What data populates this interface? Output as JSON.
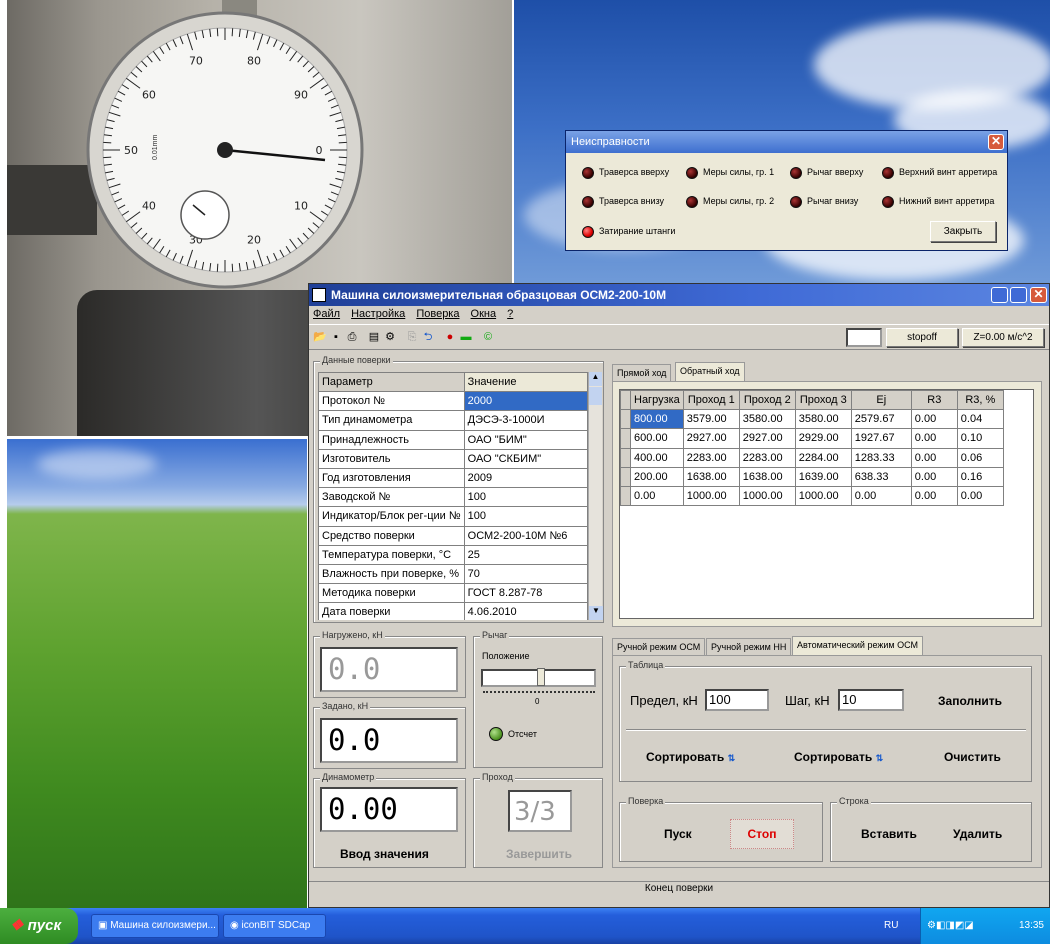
{
  "fault_dialog": {
    "title": "Неисправности",
    "items": [
      {
        "label": "Траверса вверху",
        "state": "off"
      },
      {
        "label": "Меры силы, гр. 1",
        "state": "off"
      },
      {
        "label": "Рычаг вверху",
        "state": "off"
      },
      {
        "label": "Верхний винт арретира",
        "state": "off"
      },
      {
        "label": "Траверса внизу",
        "state": "off"
      },
      {
        "label": "Меры силы, гр. 2",
        "state": "off"
      },
      {
        "label": "Рычаг внизу",
        "state": "off"
      },
      {
        "label": "Нижний винт арретира",
        "state": "off"
      },
      {
        "label": "Затирание штанги",
        "state": "on"
      }
    ],
    "close_label": "Закрыть"
  },
  "window": {
    "title": "Машина силоизмерительная образцовая ОСМ2-200-10М",
    "menu": [
      "Файл",
      "Настройка",
      "Поверка",
      "Окна",
      "?"
    ],
    "stop_button": "stopoff",
    "z_readout": "Z=0.00 м/с^2"
  },
  "params": {
    "group_label": "Данные поверки",
    "header": [
      "Параметр",
      "Значение"
    ],
    "rows": [
      [
        "Протокол №",
        "2000"
      ],
      [
        "Тип динамометра",
        "ДЭСЭ-3-1000И"
      ],
      [
        "Принадлежность",
        "ОАО \"БИМ\""
      ],
      [
        "Изготовитель",
        "ОАО \"СКБИМ\""
      ],
      [
        "Год изготовления",
        "2009"
      ],
      [
        "Заводской №",
        "100"
      ],
      [
        "Индикатор/Блок рег-ции №",
        "100"
      ],
      [
        "Средство поверки",
        "ОСМ2-200-10М №6"
      ],
      [
        "Температура поверки, °С",
        "25"
      ],
      [
        "Влажность при поверке, %",
        "70"
      ],
      [
        "Методика поверки",
        "ГОСТ 8.287-78"
      ],
      [
        "Дата поверки",
        "4.06.2010"
      ]
    ]
  },
  "results": {
    "tabs": [
      "Прямой ход",
      "Обратный ход"
    ],
    "header": [
      "Нагрузка",
      "Проход 1",
      "Проход 2",
      "Проход 3",
      "Ej",
      "R3",
      "R3, %"
    ],
    "rows": [
      [
        "800.00",
        "3579.00",
        "3580.00",
        "3580.00",
        "2579.67",
        "0.00",
        "0.04"
      ],
      [
        "600.00",
        "2927.00",
        "2927.00",
        "2929.00",
        "1927.67",
        "0.00",
        "0.10"
      ],
      [
        "400.00",
        "2283.00",
        "2283.00",
        "2284.00",
        "1283.33",
        "0.00",
        "0.06"
      ],
      [
        "200.00",
        "1638.00",
        "1638.00",
        "1639.00",
        "638.33",
        "0.00",
        "0.16"
      ],
      [
        "0.00",
        "1000.00",
        "1000.00",
        "1000.00",
        "0.00",
        "0.00",
        "0.00"
      ]
    ]
  },
  "loaded": {
    "label": "Нагружено, кН",
    "value": "0.0"
  },
  "setpoint": {
    "label": "Задано, кН",
    "value": "0.0"
  },
  "dynamometer": {
    "label": "Динамометр",
    "value": "0.00",
    "enter_label": "Ввод значения"
  },
  "lever": {
    "label": "Рычаг",
    "position_label": "Положение",
    "scale_zero": "0",
    "indicator_label": "Отсчет"
  },
  "pass": {
    "label": "Проход",
    "value": "3/3",
    "finish_label": "Завершить"
  },
  "mode": {
    "tabs": [
      "Ручной режим ОСМ",
      "Ручной режим НН",
      "Автоматический режим ОСМ"
    ],
    "table_group": "Таблица",
    "limit_label": "Предел, кН",
    "limit_value": "100",
    "step_label": "Шаг, кН",
    "step_value": "10",
    "fill_label": "Заполнить",
    "sort_label_1": "Сортировать",
    "sort_label_2": "Сортировать",
    "clear_label": "Очистить",
    "verify_group": "Поверка",
    "start_label": "Пуск",
    "stop_label": "Стоп",
    "row_group": "Строка",
    "insert_label": "Вставить",
    "delete_label": "Удалить"
  },
  "status_text": "Конец поверки",
  "taskbar": {
    "start_label": "пуск",
    "tasks": [
      "Машина силоизмери...",
      "iconBIT SDCap"
    ],
    "lang": "RU",
    "clock": "13:35"
  },
  "gauge": {
    "outer_ticks": [
      "0",
      "10",
      "20",
      "30",
      "40",
      "50",
      "60",
      "70",
      "80",
      "90"
    ],
    "face_text": "0.01mm"
  }
}
